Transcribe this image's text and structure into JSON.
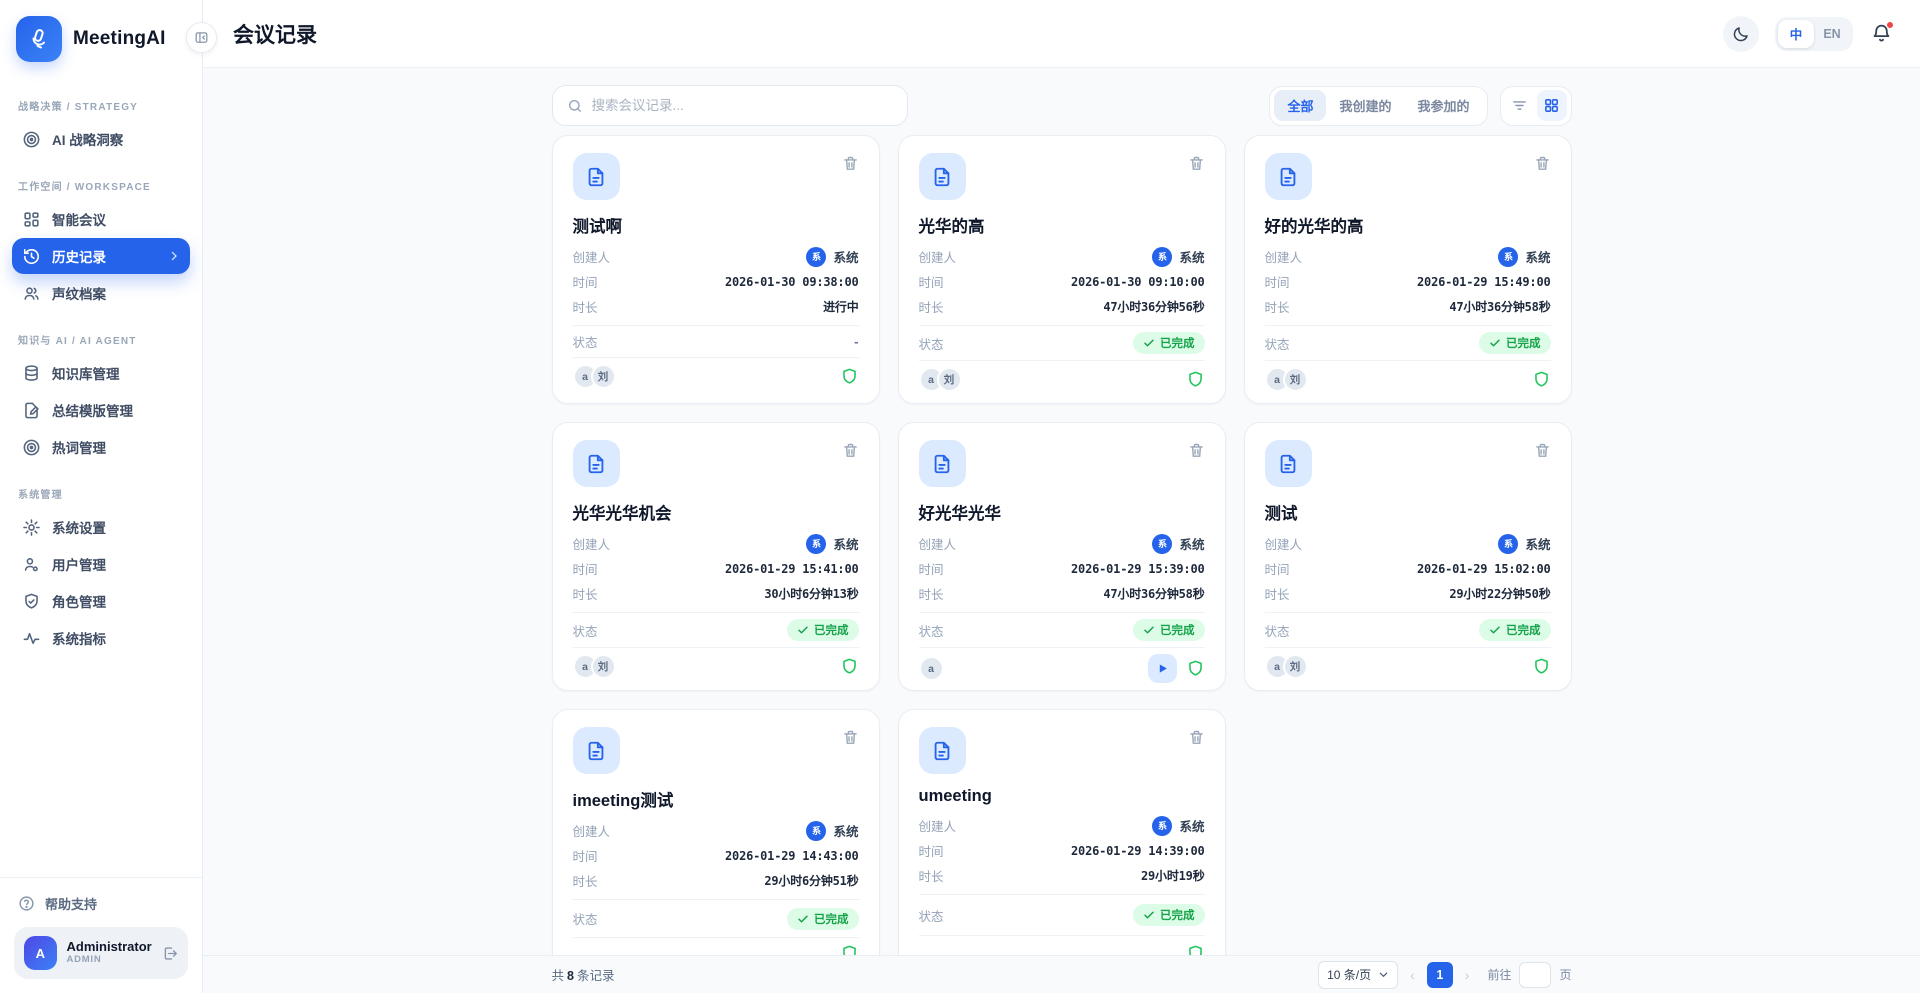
{
  "app": {
    "name": "MeetingAI"
  },
  "page": {
    "title": "会议记录"
  },
  "header": {
    "lang_zh": "中",
    "lang_en": "EN",
    "icons": {
      "theme": "moon-icon",
      "notifications": "bell-icon"
    }
  },
  "colors": {
    "accent_blue": "#2563eb",
    "chip_blue": "#dbeafe",
    "success_green": "#16a34a",
    "success_bg": "#dcfce7",
    "shield_green": "#22c55e",
    "notification_red": "#ef4444"
  },
  "sidebar": {
    "sections": [
      {
        "label": "战略决策 / STRATEGY",
        "items": [
          {
            "label": "AI 战略洞察",
            "icon": "target-icon"
          }
        ]
      },
      {
        "label": "工作空间 / WORKSPACE",
        "items": [
          {
            "label": "智能会议",
            "icon": "grid-icon"
          },
          {
            "label": "历史记录",
            "icon": "history-icon",
            "active": true
          },
          {
            "label": "声纹档案",
            "icon": "users-icon"
          }
        ]
      },
      {
        "label": "知识与 AI / AI AGENT",
        "items": [
          {
            "label": "知识库管理",
            "icon": "database-icon"
          },
          {
            "label": "总结模版管理",
            "icon": "file-pen-icon"
          },
          {
            "label": "热词管理",
            "icon": "target-icon"
          }
        ]
      },
      {
        "label": "系统管理",
        "items": [
          {
            "label": "系统设置",
            "icon": "gear-icon"
          },
          {
            "label": "用户管理",
            "icon": "user-icon"
          },
          {
            "label": "角色管理",
            "icon": "shield-check-icon"
          },
          {
            "label": "系统指标",
            "icon": "activity-icon"
          }
        ]
      }
    ],
    "help": "帮助支持",
    "user": {
      "name": "Administrator",
      "role": "ADMIN",
      "avatar": "A"
    }
  },
  "toolbar": {
    "search_placeholder": "搜索会议记录...",
    "filters": [
      "全部",
      "我创建的",
      "我参加的"
    ],
    "active_filter": "全部",
    "view_icons": [
      "filter-lines-icon",
      "grid-view-icon"
    ]
  },
  "labels": {
    "creator": "创建人",
    "time": "时间",
    "duration": "时长",
    "status": "状态",
    "status_done": "已完成",
    "status_empty": "-"
  },
  "cards": [
    {
      "title": "测试啊",
      "creator": "系统",
      "creator_avatar": "系",
      "time": "2026-01-30 09:38:00",
      "duration": "进行中",
      "status": "-",
      "participants": [
        "a",
        "刘"
      ],
      "play": false
    },
    {
      "title": "光华的高",
      "creator": "系统",
      "creator_avatar": "系",
      "time": "2026-01-30 09:10:00",
      "duration": "47小时36分钟56秒",
      "status": "已完成",
      "participants": [
        "a",
        "刘"
      ],
      "play": false
    },
    {
      "title": "好的光华的高",
      "creator": "系统",
      "creator_avatar": "系",
      "time": "2026-01-29 15:49:00",
      "duration": "47小时36分钟58秒",
      "status": "已完成",
      "participants": [
        "a",
        "刘"
      ],
      "play": false
    },
    {
      "title": "光华光华机会",
      "creator": "系统",
      "creator_avatar": "系",
      "time": "2026-01-29 15:41:00",
      "duration": "30小时6分钟13秒",
      "status": "已完成",
      "participants": [
        "a",
        "刘"
      ],
      "play": false
    },
    {
      "title": "好光华光华",
      "creator": "系统",
      "creator_avatar": "系",
      "time": "2026-01-29 15:39:00",
      "duration": "47小时36分钟58秒",
      "status": "已完成",
      "participants": [
        "a"
      ],
      "play": true
    },
    {
      "title": "测试",
      "creator": "系统",
      "creator_avatar": "系",
      "time": "2026-01-29 15:02:00",
      "duration": "29小时22分钟50秒",
      "status": "已完成",
      "participants": [
        "a",
        "刘"
      ],
      "play": false
    },
    {
      "title": "imeeting测试",
      "creator": "系统",
      "creator_avatar": "系",
      "time": "2026-01-29 14:43:00",
      "duration": "29小时6分钟51秒",
      "status": "已完成",
      "participants": [],
      "play": false
    },
    {
      "title": "umeeting",
      "creator": "系统",
      "creator_avatar": "系",
      "time": "2026-01-29 14:39:00",
      "duration": "29小时19秒",
      "status": "已完成",
      "participants": [],
      "play": false
    }
  ],
  "footer": {
    "total_prefix": "共",
    "total_count": "8",
    "total_suffix": "条记录",
    "page_size": "10 条/页",
    "prev": "‹",
    "next": "›",
    "current_page": "1",
    "goto": "前往",
    "goto_suffix": "页"
  }
}
